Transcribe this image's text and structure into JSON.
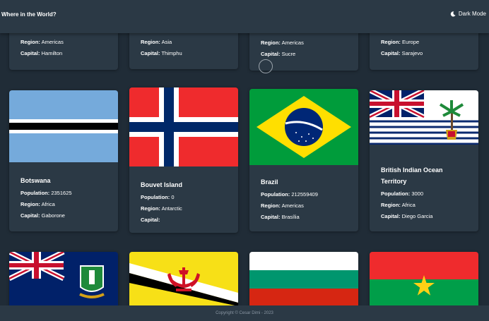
{
  "header": {
    "title": "Where in the World?",
    "mode_label": "Dark Mode",
    "mode_icon": "moon-icon"
  },
  "labels": {
    "population": "Population:",
    "region": "Region:",
    "capital": "Capital:"
  },
  "top_row": [
    {
      "name": "",
      "population": "",
      "region": "Americas",
      "capital": "Hamilton"
    },
    {
      "name": "",
      "population": "",
      "region": "Asia",
      "capital": "Thimphu"
    },
    {
      "name": "",
      "population": "",
      "region": "Americas",
      "capital": "Sucre"
    },
    {
      "name": "",
      "population": "",
      "region": "Europe",
      "capital": "Sarajevo"
    }
  ],
  "middle_row": [
    {
      "name": "Botswana",
      "population": "2351625",
      "region": "Africa",
      "capital": "Gaborone",
      "flag": "flag-botswana"
    },
    {
      "name": "Bouvet Island",
      "population": "0",
      "region": "Antarctic",
      "capital": "",
      "flag": "flag-bouvet-island"
    },
    {
      "name": "Brazil",
      "population": "212559409",
      "region": "Americas",
      "capital": "Brasília",
      "flag": "flag-brazil"
    },
    {
      "name": "British Indian Ocean Territory",
      "population": "3000",
      "region": "Africa",
      "capital": "Diego Garcia",
      "flag": "flag-british-indian-ocean-territory"
    }
  ],
  "bottom_row": [
    {
      "flag": "flag-british-virgin-islands"
    },
    {
      "flag": "flag-brunei"
    },
    {
      "flag": "flag-bulgaria"
    },
    {
      "flag": "flag-burkina-faso"
    }
  ],
  "footer": {
    "text": "Copyright © Cesar Dimi - 2023"
  },
  "colors": {
    "background": "#202c37",
    "element": "#2b3945",
    "text": "#ffffff"
  }
}
